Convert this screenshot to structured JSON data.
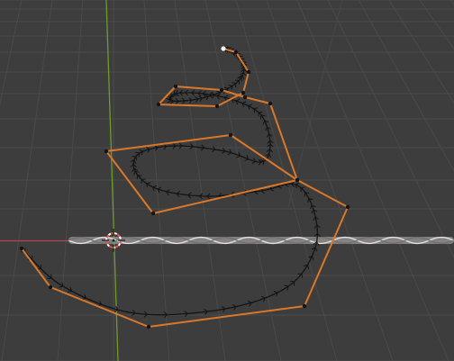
{
  "viewport": {
    "background": "#3d3d3d",
    "grid_color": "#4a4a4a",
    "x_axis_color": "#b5434f",
    "y_axis_color": "#6f9a2e",
    "control_polygon_color": "#d9782b",
    "curve_color": "#141414",
    "control_point_color": "#141414",
    "active_point_color": "#f2f2f2",
    "cursor_color": "#e85050"
  },
  "icons": {
    "cursor": "3d-cursor-icon"
  }
}
